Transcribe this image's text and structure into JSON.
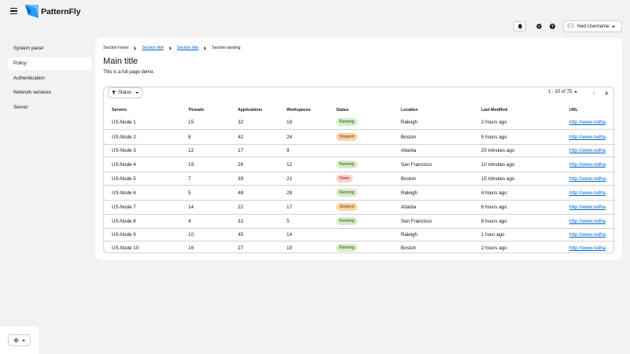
{
  "brand": {
    "name": "PatternFly"
  },
  "masthead": {
    "user_name": "Ned Username",
    "icons": [
      "bell-icon",
      "gear-icon",
      "help-icon"
    ]
  },
  "sidebar": {
    "items": [
      {
        "label": "System panel",
        "active": false
      },
      {
        "label": "Policy",
        "active": true
      },
      {
        "label": "Authentication",
        "active": false
      },
      {
        "label": "Network services",
        "active": false
      },
      {
        "label": "Server",
        "active": false
      }
    ]
  },
  "breadcrumb": [
    "Section home",
    "Section title",
    "Section title",
    "Section landing"
  ],
  "page": {
    "title": "Main title",
    "description": "This is a full page demo."
  },
  "toolbar": {
    "filter_label": "Status",
    "pagination": "1 - 10 of 75"
  },
  "table": {
    "headers": {
      "server": "Servers",
      "threads": "Threads",
      "apps": "Applications",
      "ws": "Workspaces",
      "status": "Status",
      "loc": "Location",
      "mod": "Last Modified",
      "url": "URL"
    },
    "rows": [
      {
        "server": "US-Node 1",
        "threads": "15",
        "apps": "32",
        "ws": "18",
        "status": "Running",
        "loc": "Raleigh",
        "mod": "2 hours ago",
        "url": "http://www.redhat.com"
      },
      {
        "server": "US-Node 2",
        "threads": "8",
        "apps": "42",
        "ws": "24",
        "status": "Stopped",
        "loc": "Boston",
        "mod": "5 hours ago",
        "url": "http://www.redhat.com"
      },
      {
        "server": "US-Node 3",
        "threads": "12",
        "apps": "17",
        "ws": "9",
        "status": "",
        "loc": "Atlanta",
        "mod": "20 minutes ago",
        "url": "http://www.redhat.com"
      },
      {
        "server": "US-Node 4",
        "threads": "19",
        "apps": "26",
        "ws": "12",
        "status": "Running",
        "loc": "San Francisco",
        "mod": "10 minutes ago",
        "url": "http://www.redhat.com"
      },
      {
        "server": "US-Node 5",
        "threads": "7",
        "apps": "39",
        "ws": "21",
        "status": "Down",
        "loc": "Boston",
        "mod": "15 minutes ago",
        "url": "http://www.redhat.com"
      },
      {
        "server": "US-Node 6",
        "threads": "5",
        "apps": "48",
        "ws": "28",
        "status": "Running",
        "loc": "Raleigh",
        "mod": "4 hours ago",
        "url": "http://www.redhat.com"
      },
      {
        "server": "US-Node 7",
        "threads": "14",
        "apps": "22",
        "ws": "17",
        "status": "Stopped",
        "loc": "Atlanta",
        "mod": "6 hours ago",
        "url": "http://www.redhat.com"
      },
      {
        "server": "US-Node 8",
        "threads": "4",
        "apps": "31",
        "ws": "5",
        "status": "Running",
        "loc": "San Francisco",
        "mod": "8 hours ago",
        "url": "http://www.redhat.com"
      },
      {
        "server": "US-Node 9",
        "threads": "10",
        "apps": "45",
        "ws": "14",
        "status": "",
        "loc": "Raleigh",
        "mod": "1 hour ago",
        "url": "http://www.redhat.com"
      },
      {
        "server": "US-Node 10",
        "threads": "16",
        "apps": "27",
        "ws": "19",
        "status": "Running",
        "loc": "Boston",
        "mod": "2 hours ago",
        "url": "http://www.redhat.com"
      }
    ]
  },
  "colors": {
    "background": "#f2f2f2",
    "surface": "#ffffff",
    "link": "#0066cc",
    "brand_blue": "#2b9af3",
    "running": "#d6ecc6",
    "stopped": "#fbd4a8",
    "down": "#fbd0cf"
  }
}
